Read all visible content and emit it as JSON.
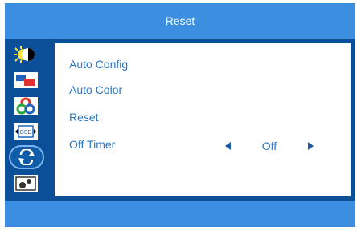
{
  "title": "Reset",
  "icons": [
    {
      "name": "brightness-contrast-icon"
    },
    {
      "name": "image-settings-icon"
    },
    {
      "name": "color-icon"
    },
    {
      "name": "osd-settings-icon"
    },
    {
      "name": "reset-icon",
      "selected": true
    },
    {
      "name": "extra-settings-icon"
    }
  ],
  "menu": {
    "items": [
      {
        "label": "Auto Config"
      },
      {
        "label": "Auto Color"
      },
      {
        "label": "Reset"
      },
      {
        "label": "Off Timer"
      }
    ],
    "off_timer_value": "Off"
  },
  "colors": {
    "accent": "#3b8ee0",
    "frame": "#0a4f97",
    "text": "#2a78c8"
  }
}
